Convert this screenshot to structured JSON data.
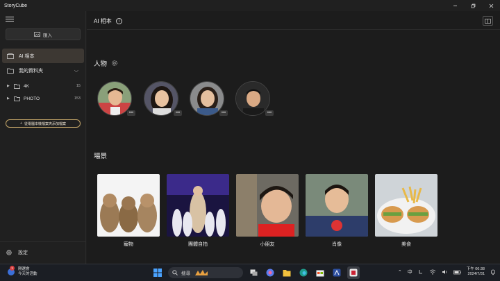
{
  "app": {
    "title": "StoryCube"
  },
  "sidebar": {
    "import_label": "匯入",
    "nav_active": "AI 相本",
    "nav_mine": "我的資料夾",
    "folders": [
      {
        "name": "4K",
        "count": "15"
      },
      {
        "name": "PHOTO",
        "count": "153"
      }
    ],
    "add_folder_label": "從電腦本機檔案夾添加檔案",
    "settings_label": "設定"
  },
  "main": {
    "page_title": "AI 相本",
    "people_title": "人物",
    "scenes_title": "場景",
    "scenes": [
      {
        "caption": "寵物"
      },
      {
        "caption": "團體自拍"
      },
      {
        "caption": "小朋友"
      },
      {
        "caption": "肖像"
      },
      {
        "caption": "美食"
      }
    ],
    "more_label": "•••"
  },
  "taskbar": {
    "weather_title": "剛選會",
    "weather_sub": "今天的活動",
    "weather_badge": "1",
    "search_placeholder": "搜尋",
    "ime": "中",
    "time": "下午 06:38",
    "date": "2024/7/31"
  },
  "colors": {
    "accent": "#c7a86a",
    "active_nav": "#3d3833",
    "background": "#1c1c1c"
  }
}
